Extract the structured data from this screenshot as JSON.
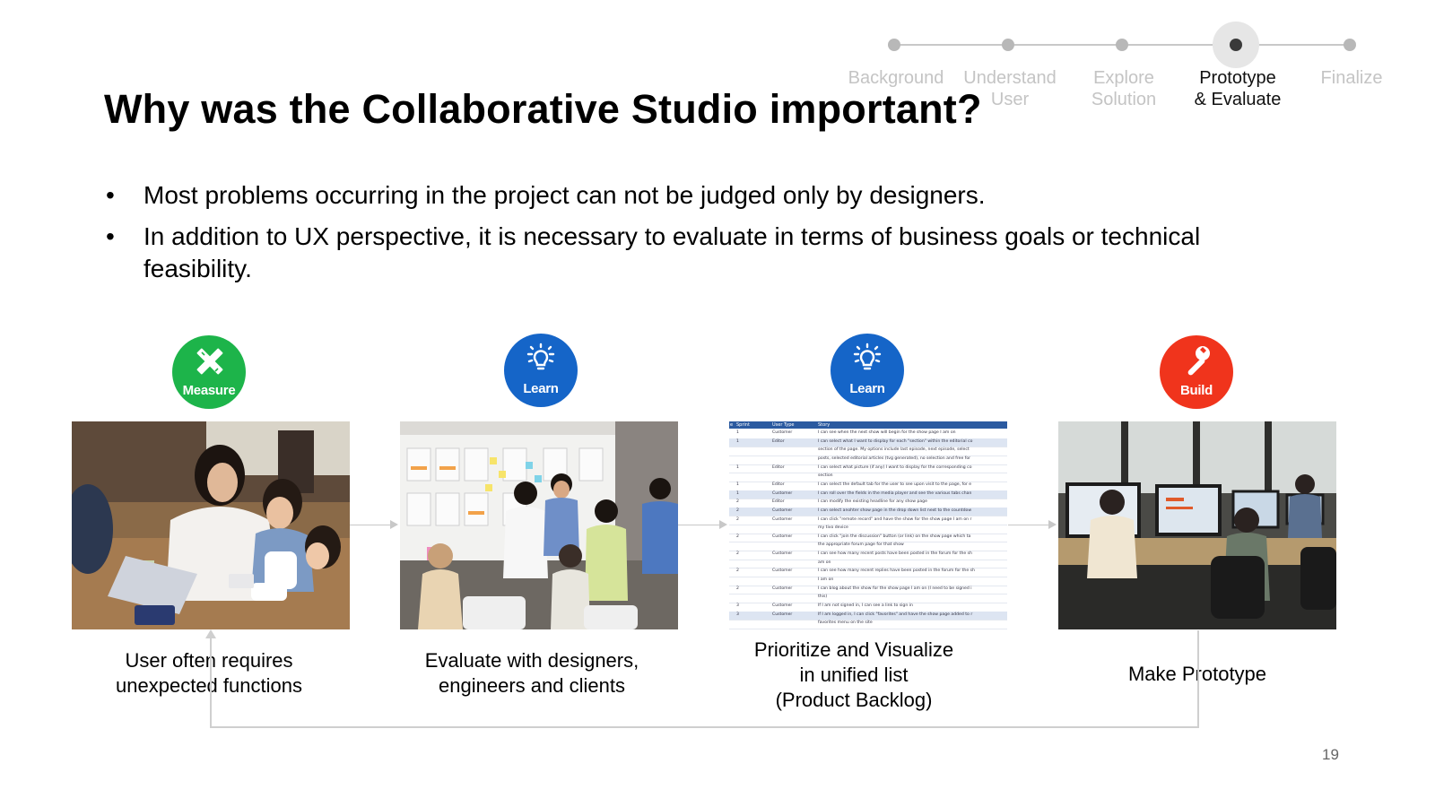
{
  "stepper": {
    "steps": [
      {
        "label": "Background",
        "active": false
      },
      {
        "label": "Understand\nUser",
        "active": false
      },
      {
        "label": "Explore\nSolution",
        "active": false
      },
      {
        "label": "Prototype\n& Evaluate",
        "active": true
      },
      {
        "label": "Finalize",
        "active": false
      }
    ]
  },
  "title": "Why was the Collaborative Studio important?",
  "bullets": [
    "Most problems occurring in the project can not be judged only by designers.",
    "In addition to UX perspective, it is necessary to evaluate in terms of business goals or technical feasibility."
  ],
  "flow": [
    {
      "badge": "Measure",
      "badge_icon": "pencil-ruler-icon",
      "badge_color": "#1db44a",
      "caption": "User often requires\nunexpected functions"
    },
    {
      "badge": "Learn",
      "badge_icon": "lightbulb-icon",
      "badge_color": "#1565c8",
      "caption": "Evaluate with designers,\nengineers and clients"
    },
    {
      "badge": "Learn",
      "badge_icon": "lightbulb-icon",
      "badge_color": "#1565c8",
      "caption": "Prioritize and Visualize\nin unified list\n(Product Backlog)"
    },
    {
      "badge": "Build",
      "badge_icon": "wrench-icon",
      "badge_color": "#f0341c",
      "caption": "Make Prototype"
    }
  ],
  "backlog": {
    "headers": [
      "e",
      "Sprint",
      "User Type",
      "Story"
    ],
    "rows": [
      {
        "sprint": "1",
        "type": "Customer",
        "story": "I can see when the next show will begin for the show page I am on"
      },
      {
        "sprint": "1",
        "type": "Editor",
        "story": "I can select what I want to display for each \"section\" within the editorial co"
      },
      {
        "sprint": "",
        "type": "",
        "story": "section of the page. My options include last episode, next episode, select"
      },
      {
        "sprint": "",
        "type": "",
        "story": "posts, selected editorial articles (tvg generated), no selection and free for"
      },
      {
        "sprint": "1",
        "type": "Editor",
        "story": "I can select what picture (if any) I want to display for the corresponding co"
      },
      {
        "sprint": "",
        "type": "",
        "story": "section"
      },
      {
        "sprint": "1",
        "type": "Editor",
        "story": "I can select the default tab for the user to see upon visit to the page, for e"
      },
      {
        "sprint": "1",
        "type": "Customer",
        "story": "I can roll over the fields in the media player and see the various tabs chan"
      },
      {
        "sprint": "2",
        "type": "Editor",
        "story": "I can modify the existing headline for any show page"
      },
      {
        "sprint": "2",
        "type": "Customer",
        "story": "I can select anohter show page in the drop down list next to the countdow"
      },
      {
        "sprint": "2",
        "type": "Customer",
        "story": "I can click \"remote record\" and have the show for the show page I am on r"
      },
      {
        "sprint": "",
        "type": "",
        "story": "my tivo device"
      },
      {
        "sprint": "2",
        "type": "Customer",
        "story": "I can click \"join the discussion\" button (or link) on the show page which ta"
      },
      {
        "sprint": "",
        "type": "",
        "story": "the appropriate forum page for that show"
      },
      {
        "sprint": "2",
        "type": "Customer",
        "story": "I can see how many recent posts have been posted in the forum for the sh"
      },
      {
        "sprint": "",
        "type": "",
        "story": "am on"
      },
      {
        "sprint": "2",
        "type": "Customer",
        "story": "I can see how many recent replies have been posted in the forum for the sh"
      },
      {
        "sprint": "",
        "type": "",
        "story": "I am on"
      },
      {
        "sprint": "2",
        "type": "Customer",
        "story": "I can blog about the show for the show page I am on (I need to be signed i"
      },
      {
        "sprint": "",
        "type": "",
        "story": "this)"
      },
      {
        "sprint": "3",
        "type": "Customer",
        "story": "If I am not signed in, I can see a link to sign in"
      },
      {
        "sprint": "3",
        "type": "Customer",
        "story": "If I am logged in, I can click \"favorites\" and have the show page added to r"
      },
      {
        "sprint": "",
        "type": "",
        "story": "favorites menu on the site"
      }
    ]
  },
  "page_number": "19"
}
